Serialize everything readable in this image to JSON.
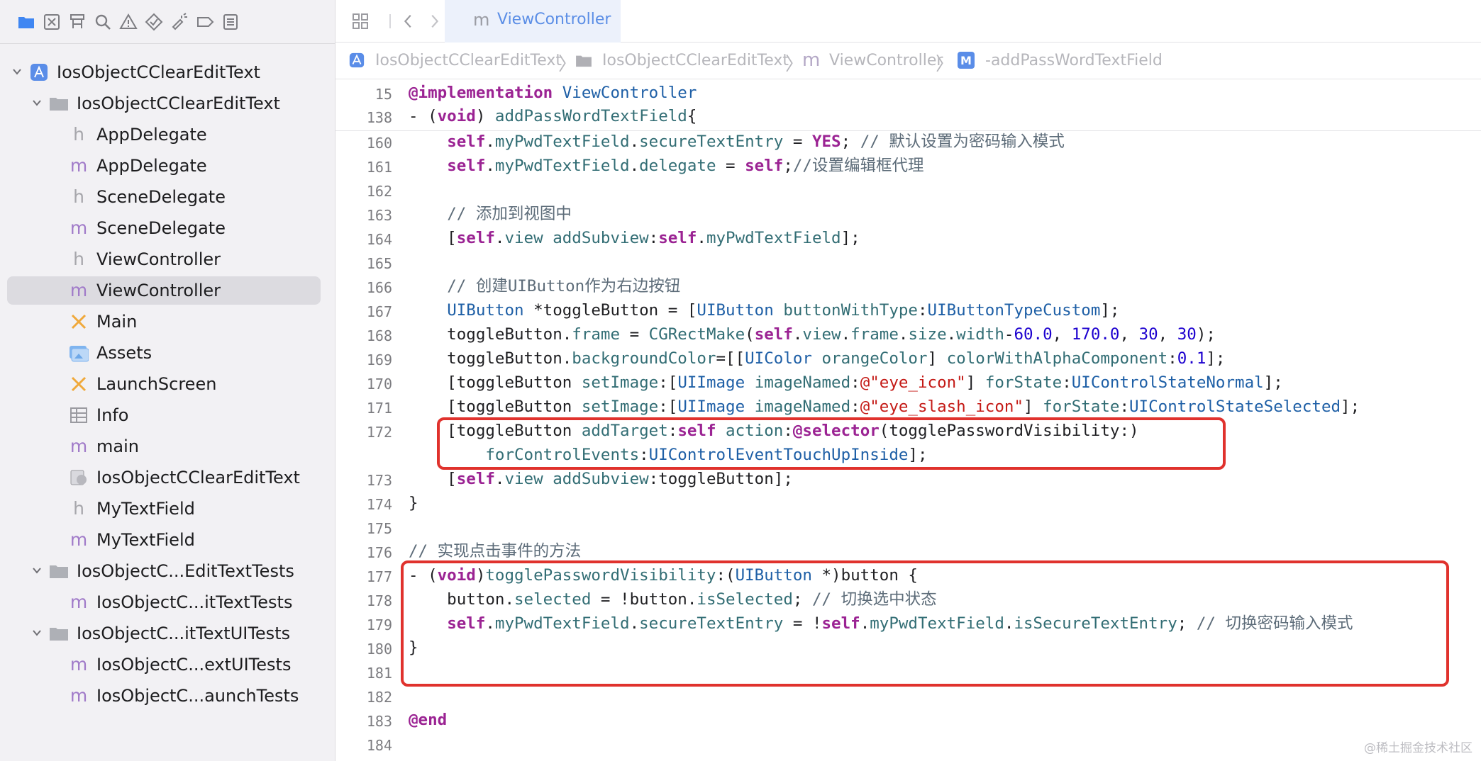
{
  "navigator": {
    "toolbar_icons": [
      "folder-icon",
      "source-control-icon",
      "hierarchy-icon",
      "search-icon",
      "warning-icon",
      "test-icon",
      "debug-icon",
      "breakpoint-icon",
      "report-icon"
    ],
    "tree": [
      {
        "label": "IosObjectCClearEditText",
        "icon": "project-icon",
        "level": 0,
        "expanded": true
      },
      {
        "label": "IosObjectCClearEditText",
        "icon": "folder-icon",
        "level": 1,
        "expanded": true
      },
      {
        "label": "AppDelegate",
        "icon": "h",
        "level": 2
      },
      {
        "label": "AppDelegate",
        "icon": "m",
        "level": 2
      },
      {
        "label": "SceneDelegate",
        "icon": "h",
        "level": 2
      },
      {
        "label": "SceneDelegate",
        "icon": "m",
        "level": 2
      },
      {
        "label": "ViewController",
        "icon": "h",
        "level": 2
      },
      {
        "label": "ViewController",
        "icon": "m",
        "level": 2,
        "selected": true
      },
      {
        "label": "Main",
        "icon": "storyboard-icon",
        "level": 2
      },
      {
        "label": "Assets",
        "icon": "assets-icon",
        "level": 2
      },
      {
        "label": "LaunchScreen",
        "icon": "storyboard-icon",
        "level": 2
      },
      {
        "label": "Info",
        "icon": "plist-icon",
        "level": 2
      },
      {
        "label": "main",
        "icon": "m",
        "level": 2
      },
      {
        "label": "IosObjectCClearEditText",
        "icon": "entitlements-icon",
        "level": 2
      },
      {
        "label": "MyTextField",
        "icon": "h",
        "level": 2
      },
      {
        "label": "MyTextField",
        "icon": "m",
        "level": 2
      },
      {
        "label": "IosObjectC...EditTextTests",
        "icon": "folder-icon",
        "level": 1,
        "expanded": true
      },
      {
        "label": "IosObjectC...itTextTests",
        "icon": "m",
        "level": 2
      },
      {
        "label": "IosObjectC...itTextUITests",
        "icon": "folder-icon",
        "level": 1,
        "expanded": true
      },
      {
        "label": "IosObjectC...extUITests",
        "icon": "m",
        "level": 2
      },
      {
        "label": "IosObjectC...aunchTests",
        "icon": "m",
        "level": 2
      }
    ]
  },
  "editor": {
    "tab": {
      "glyph": "m",
      "label": "ViewController"
    },
    "breadcrumb": [
      {
        "label": "IosObjectCClearEditText",
        "icon": "project-icon"
      },
      {
        "label": "IosObjectCClearEditText",
        "icon": "folder-icon"
      },
      {
        "label": "ViewController",
        "icon": "m"
      },
      {
        "label": "-addPassWordTextField",
        "icon": "method-icon"
      }
    ],
    "sticky_lines": [
      {
        "num": "15",
        "tokens": [
          [
            "kw",
            "@implementation"
          ],
          [
            "plain",
            " "
          ],
          [
            "cls",
            "ViewController"
          ]
        ]
      },
      {
        "num": "138",
        "tokens": [
          [
            "plain",
            "- ("
          ],
          [
            "kw",
            "void"
          ],
          [
            "plain",
            ") "
          ],
          [
            "mth",
            "addPassWordTextField"
          ],
          [
            "plain",
            "{"
          ]
        ]
      }
    ],
    "lines": [
      {
        "num": "160",
        "tokens": [
          [
            "plain",
            "    "
          ],
          [
            "kw",
            "self"
          ],
          [
            "plain",
            "."
          ],
          [
            "mth",
            "myPwdTextField"
          ],
          [
            "plain",
            "."
          ],
          [
            "mth",
            "secureTextEntry"
          ],
          [
            "plain",
            " = "
          ],
          [
            "kw",
            "YES"
          ],
          [
            "plain",
            "; "
          ],
          [
            "cmt",
            "// 默认设置为密码输入模式"
          ]
        ]
      },
      {
        "num": "161",
        "tokens": [
          [
            "plain",
            "    "
          ],
          [
            "kw",
            "self"
          ],
          [
            "plain",
            "."
          ],
          [
            "mth",
            "myPwdTextField"
          ],
          [
            "plain",
            "."
          ],
          [
            "mth",
            "delegate"
          ],
          [
            "plain",
            " = "
          ],
          [
            "kw",
            "self"
          ],
          [
            "plain",
            ";"
          ],
          [
            "cmt",
            "//设置编辑框代理"
          ]
        ]
      },
      {
        "num": "162",
        "tokens": []
      },
      {
        "num": "163",
        "tokens": [
          [
            "plain",
            "    "
          ],
          [
            "cmt",
            "// 添加到视图中"
          ]
        ]
      },
      {
        "num": "164",
        "tokens": [
          [
            "plain",
            "    ["
          ],
          [
            "kw",
            "self"
          ],
          [
            "plain",
            "."
          ],
          [
            "mth",
            "view"
          ],
          [
            "plain",
            " "
          ],
          [
            "mth",
            "addSubview"
          ],
          [
            "plain",
            ":"
          ],
          [
            "kw",
            "self"
          ],
          [
            "plain",
            "."
          ],
          [
            "mth",
            "myPwdTextField"
          ],
          [
            "plain",
            "];"
          ]
        ]
      },
      {
        "num": "165",
        "tokens": []
      },
      {
        "num": "166",
        "tokens": [
          [
            "plain",
            "    "
          ],
          [
            "cmt",
            "// 创建UIButton作为右边按钮"
          ]
        ]
      },
      {
        "num": "167",
        "tokens": [
          [
            "plain",
            "    "
          ],
          [
            "cls",
            "UIButton"
          ],
          [
            "plain",
            " *toggleButton = ["
          ],
          [
            "cls",
            "UIButton"
          ],
          [
            "plain",
            " "
          ],
          [
            "mth",
            "buttonWithType"
          ],
          [
            "plain",
            ":"
          ],
          [
            "cst",
            "UIButtonTypeCustom"
          ],
          [
            "plain",
            "];"
          ]
        ]
      },
      {
        "num": "168",
        "tokens": [
          [
            "plain",
            "    toggleButton."
          ],
          [
            "mth",
            "frame"
          ],
          [
            "plain",
            " = "
          ],
          [
            "mth",
            "CGRectMake"
          ],
          [
            "plain",
            "("
          ],
          [
            "kw",
            "self"
          ],
          [
            "plain",
            "."
          ],
          [
            "mth",
            "view"
          ],
          [
            "plain",
            "."
          ],
          [
            "mth",
            "frame"
          ],
          [
            "plain",
            "."
          ],
          [
            "mth",
            "size"
          ],
          [
            "plain",
            "."
          ],
          [
            "mth",
            "width"
          ],
          [
            "plain",
            "-"
          ],
          [
            "num",
            "60.0"
          ],
          [
            "plain",
            ", "
          ],
          [
            "num",
            "170.0"
          ],
          [
            "plain",
            ", "
          ],
          [
            "num",
            "30"
          ],
          [
            "plain",
            ", "
          ],
          [
            "num",
            "30"
          ],
          [
            "plain",
            ");"
          ]
        ]
      },
      {
        "num": "169",
        "tokens": [
          [
            "plain",
            "    toggleButton."
          ],
          [
            "mth",
            "backgroundColor"
          ],
          [
            "plain",
            "=[["
          ],
          [
            "cls",
            "UIColor"
          ],
          [
            "plain",
            " "
          ],
          [
            "mth",
            "orangeColor"
          ],
          [
            "plain",
            "] "
          ],
          [
            "mth",
            "colorWithAlphaComponent"
          ],
          [
            "plain",
            ":"
          ],
          [
            "num",
            "0.1"
          ],
          [
            "plain",
            "];"
          ]
        ]
      },
      {
        "num": "170",
        "tokens": [
          [
            "plain",
            "    [toggleButton "
          ],
          [
            "mth",
            "setImage"
          ],
          [
            "plain",
            ":["
          ],
          [
            "cls",
            "UIImage"
          ],
          [
            "plain",
            " "
          ],
          [
            "mth",
            "imageNamed"
          ],
          [
            "plain",
            ":"
          ],
          [
            "str",
            "@\"eye_icon\""
          ],
          [
            "plain",
            "] "
          ],
          [
            "mth",
            "forState"
          ],
          [
            "plain",
            ":"
          ],
          [
            "cst",
            "UIControlStateNormal"
          ],
          [
            "plain",
            "];"
          ]
        ]
      },
      {
        "num": "171",
        "tokens": [
          [
            "plain",
            "    [toggleButton "
          ],
          [
            "mth",
            "setImage"
          ],
          [
            "plain",
            ":["
          ],
          [
            "cls",
            "UIImage"
          ],
          [
            "plain",
            " "
          ],
          [
            "mth",
            "imageNamed"
          ],
          [
            "plain",
            ":"
          ],
          [
            "str",
            "@\"eye_slash_icon\""
          ],
          [
            "plain",
            "] "
          ],
          [
            "mth",
            "forState"
          ],
          [
            "plain",
            ":"
          ],
          [
            "cst",
            "UIControlStateSelected"
          ],
          [
            "plain",
            "];"
          ]
        ]
      },
      {
        "num": "172",
        "tokens": [
          [
            "plain",
            "    [toggleButton "
          ],
          [
            "mth",
            "addTarget"
          ],
          [
            "plain",
            ":"
          ],
          [
            "kw",
            "self"
          ],
          [
            "plain",
            " "
          ],
          [
            "mth",
            "action"
          ],
          [
            "plain",
            ":"
          ],
          [
            "kw",
            "@selector"
          ],
          [
            "plain",
            "(togglePasswordVisibility:)"
          ]
        ]
      },
      {
        "num": "",
        "tokens": [
          [
            "plain",
            "        "
          ],
          [
            "mth",
            "forControlEvents"
          ],
          [
            "plain",
            ":"
          ],
          [
            "cst",
            "UIControlEventTouchUpInside"
          ],
          [
            "plain",
            "];"
          ]
        ]
      },
      {
        "num": "173",
        "tokens": [
          [
            "plain",
            "    ["
          ],
          [
            "kw",
            "self"
          ],
          [
            "plain",
            "."
          ],
          [
            "mth",
            "view"
          ],
          [
            "plain",
            " "
          ],
          [
            "mth",
            "addSubview"
          ],
          [
            "plain",
            ":toggleButton];"
          ]
        ]
      },
      {
        "num": "174",
        "tokens": [
          [
            "plain",
            "}"
          ]
        ]
      },
      {
        "num": "175",
        "tokens": []
      },
      {
        "num": "176",
        "tokens": [
          [
            "cmt",
            "// 实现点击事件的方法"
          ]
        ]
      },
      {
        "num": "177",
        "tokens": [
          [
            "plain",
            "- ("
          ],
          [
            "kw",
            "void"
          ],
          [
            "plain",
            ")"
          ],
          [
            "mth",
            "togglePasswordVisibility"
          ],
          [
            "plain",
            ":("
          ],
          [
            "cls",
            "UIButton"
          ],
          [
            "plain",
            " *)button {"
          ]
        ]
      },
      {
        "num": "178",
        "tokens": [
          [
            "plain",
            "    button."
          ],
          [
            "mth",
            "selected"
          ],
          [
            "plain",
            " = !button."
          ],
          [
            "mth",
            "isSelected"
          ],
          [
            "plain",
            "; "
          ],
          [
            "cmt",
            "// 切换选中状态"
          ]
        ]
      },
      {
        "num": "179",
        "tokens": [
          [
            "plain",
            "    "
          ],
          [
            "kw",
            "self"
          ],
          [
            "plain",
            "."
          ],
          [
            "mth",
            "myPwdTextField"
          ],
          [
            "plain",
            "."
          ],
          [
            "mth",
            "secureTextEntry"
          ],
          [
            "plain",
            " = !"
          ],
          [
            "kw",
            "self"
          ],
          [
            "plain",
            "."
          ],
          [
            "mth",
            "myPwdTextField"
          ],
          [
            "plain",
            "."
          ],
          [
            "mth",
            "isSecureTextEntry"
          ],
          [
            "plain",
            "; "
          ],
          [
            "cmt",
            "// 切换密码输入模式"
          ]
        ]
      },
      {
        "num": "180",
        "tokens": [
          [
            "plain",
            "}"
          ]
        ]
      },
      {
        "num": "181",
        "tokens": []
      },
      {
        "num": "182",
        "tokens": []
      },
      {
        "num": "183",
        "tokens": [
          [
            "kw",
            "@end"
          ]
        ]
      },
      {
        "num": "184",
        "tokens": []
      }
    ]
  },
  "watermark": "@稀土掘金技术社区",
  "colors": {
    "keyword": "#9b2393",
    "method": "#326d74",
    "class": "#1e5fa6",
    "number": "#1c00cf",
    "string": "#c41a16",
    "comment": "#5d6c79",
    "annotation_box": "#e0322d",
    "selection": "#dcdbe0"
  }
}
